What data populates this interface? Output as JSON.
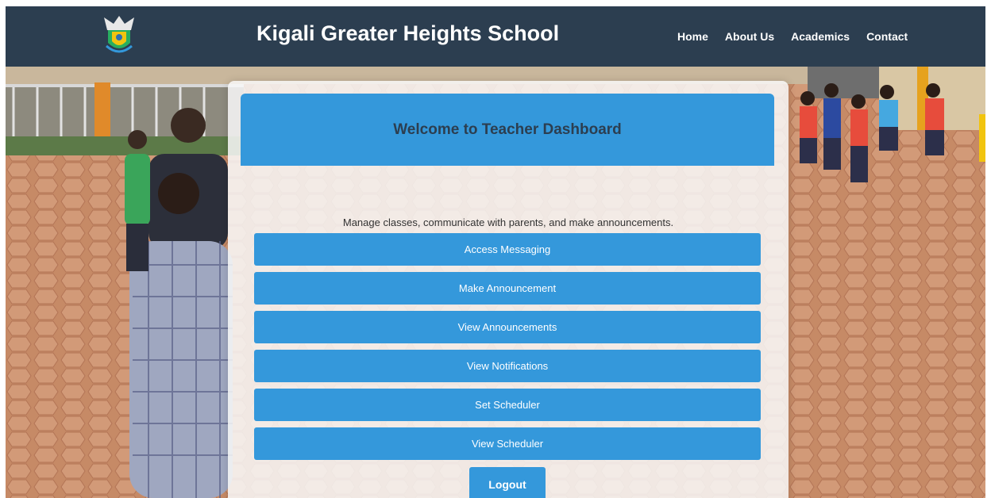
{
  "header": {
    "title": "Kigali Greater Heights School",
    "nav": [
      {
        "label": "Home"
      },
      {
        "label": "About Us"
      },
      {
        "label": "Academics"
      },
      {
        "label": "Contact"
      }
    ]
  },
  "logo": {
    "icon": "school-crest-icon"
  },
  "dashboard": {
    "title": "Welcome to Teacher Dashboard",
    "subtitle": "Manage classes, communicate with parents, and make announcements.",
    "actions": [
      {
        "label": "Access Messaging"
      },
      {
        "label": "Make Announcement"
      },
      {
        "label": "View Announcements"
      },
      {
        "label": "View Notifications"
      },
      {
        "label": "Set Scheduler"
      },
      {
        "label": "View Scheduler"
      }
    ],
    "logout_label": "Logout"
  },
  "colors": {
    "header_bg": "#2c3e50",
    "accent": "#3498db",
    "header_text": "#2c3e50"
  }
}
